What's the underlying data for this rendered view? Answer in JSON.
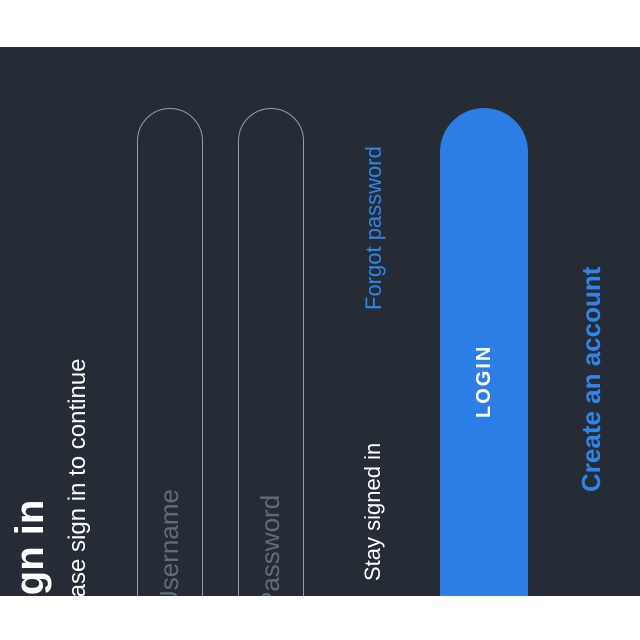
{
  "header": {
    "title": "Sign in",
    "subtitle": "Please sign in to continue"
  },
  "form": {
    "username_placeholder": "Username",
    "password_placeholder": "Password",
    "forgot_password": "Forgot password",
    "stay_signed_in": "Stay signed in",
    "stay_signed_in_checked": true,
    "login_label": "LOGIN",
    "create_account": "Create an account"
  },
  "colors": {
    "background": "#262c35",
    "accent": "#2d7de6",
    "text": "#ffffff",
    "field_border": "#8fa0a6",
    "placeholder": "#5f6e75"
  },
  "icons": {
    "checkbox": "check-icon"
  }
}
